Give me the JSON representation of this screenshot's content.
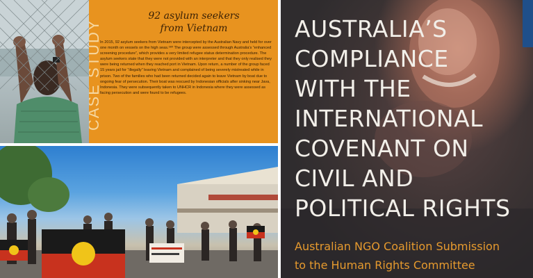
{
  "case_study": {
    "tag": "CASE STUDY",
    "title_line1": "92 asylum seekers",
    "title_line2": "from Vietnam",
    "body": "In 2015, 92 asylum seekers from Vietnam were intercepted by the Australian Navy and held for over one month on vessels on the high seas.³⁸⁰ The group were assessed through Australia's “enhanced screening procedure”, which provides a very limited refugee status determination procedure. The asylum seekers state that they were not provided with an interpreter and that they only realised they were being returned when they reached port in Vietnam. Upon return, a number of the group faced 15 years jail for “illegally” leaving Vietnam and complained of being severely mistreated while in prison. Two of the families who had been returned decided again to leave Vietnam by boat due to ongoing fear of persecution. Their boat was rescued by Indonesian officials after sinking near Java, Indonesia. They were subsequently taken to UNHCR in Indonesia where they were assessed as facing persecution and were found to be refugees."
  },
  "cover": {
    "title_lines": [
      "AUSTRALIA’S",
      "COMPLIANCE",
      "WITH THE",
      "INTERNATIONAL",
      "COVENANT ON",
      "CIVIL AND",
      "POLITICAL RIGHTS"
    ],
    "subtitle_lines": [
      "Australian NGO Coalition Submission",
      "to the Human Rights Committee"
    ]
  },
  "colors": {
    "orange_panel": "#e8931f",
    "cover_title": "#f2efe9",
    "cover_subtitle": "#e69a2e",
    "corner_tab": "#1f4f8a"
  }
}
